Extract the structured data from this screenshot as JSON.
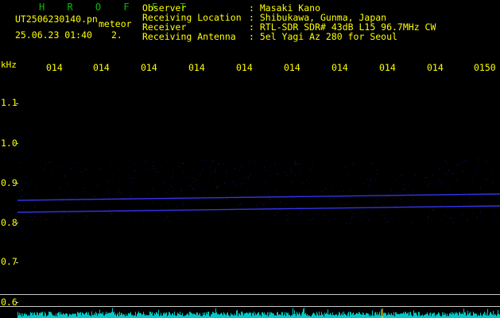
{
  "header": {
    "brand": "H R O F F T",
    "filename": "UT2506230140.pn",
    "mode": "meteor",
    "datetime": "25.06.23 01:40",
    "index": "2.",
    "info": [
      {
        "label": "Observer",
        "value": ": Masaki Kano"
      },
      {
        "label": "Receiving Location",
        "value": ": Shibukawa, Gunma, Japan"
      },
      {
        "label": "Receiver",
        "value": ": RTL-SDR SDR# 43dB L15 96.7MHz CW"
      },
      {
        "label": "Receiving Antenna",
        "value": ": 5el Yagi Az 280 for Seoul"
      }
    ]
  },
  "colors": {
    "header_text": "#ffff00",
    "brand": "#00c000",
    "axis": "#c8c8c8",
    "signal": "#3a3aff",
    "noise_spectrum": "#00c8c8"
  },
  "chart_data": {
    "type": "heatmap",
    "title": "",
    "ylabel": "kHz",
    "xlabel": "",
    "x_tick_labels": [
      "014",
      "014",
      "014",
      "014",
      "014",
      "014",
      "014",
      "014",
      "014",
      "0150"
    ],
    "y_tick_labels": [
      "1.1",
      "1.0",
      "0.9",
      "0.8",
      "0.7",
      "0.6"
    ],
    "ylim": [
      0.6,
      1.1
    ],
    "signal_traces": [
      {
        "freq_khz_start": 0.856,
        "freq_khz_end": 0.872
      },
      {
        "freq_khz_start": 0.826,
        "freq_khz_end": 0.842
      }
    ],
    "reference_lines_khz": [
      0.618,
      0.585
    ]
  }
}
